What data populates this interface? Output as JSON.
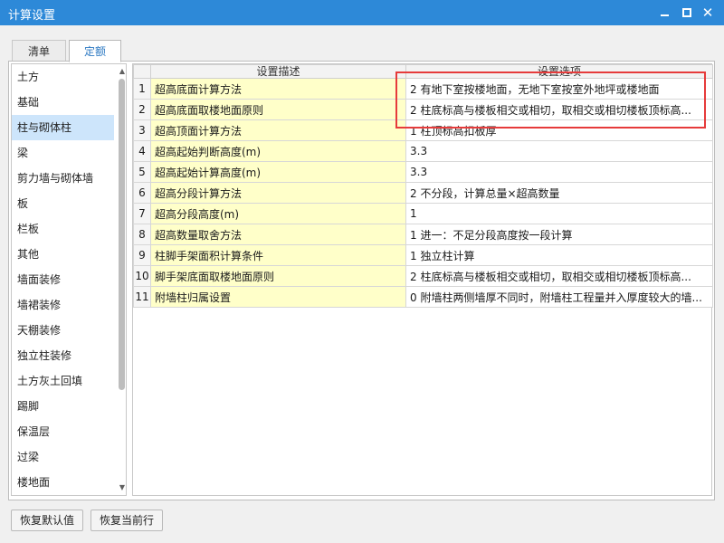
{
  "window": {
    "title": "计算设置"
  },
  "tabs": [
    "清单",
    "定额"
  ],
  "active_tab": "定额",
  "categories": [
    "土方",
    "基础",
    "柱与砌体柱",
    "梁",
    "剪力墙与砌体墙",
    "板",
    "栏板",
    "其他",
    "墙面装修",
    "墙裙装修",
    "天棚装修",
    "独立柱装修",
    "土方灰土回填",
    "踢脚",
    "保温层",
    "过梁",
    "楼地面"
  ],
  "selected_category": "柱与砌体柱",
  "table": {
    "headers": [
      "",
      "设置描述",
      "设置选项"
    ],
    "rows": [
      {
        "num": "1",
        "desc": "超高底面计算方法",
        "value": "2 有地下室按楼地面，无地下室按室外地坪或楼地面"
      },
      {
        "num": "2",
        "desc": "超高底面取楼地面原则",
        "value": "2 柱底标高与楼板相交或相切，取相交或相切楼板顶标高..."
      },
      {
        "num": "3",
        "desc": "超高顶面计算方法",
        "value": "1 柱顶标高扣板厚"
      },
      {
        "num": "4",
        "desc": "超高起始判断高度(m)",
        "value": "3.3"
      },
      {
        "num": "5",
        "desc": "超高起始计算高度(m)",
        "value": "3.3"
      },
      {
        "num": "6",
        "desc": "超高分段计算方法",
        "value": "2 不分段，计算总量×超高数量"
      },
      {
        "num": "7",
        "desc": "超高分段高度(m)",
        "value": "1"
      },
      {
        "num": "8",
        "desc": "超高数量取舍方法",
        "value": "1 进一：不足分段高度按一段计算"
      },
      {
        "num": "9",
        "desc": "柱脚手架面积计算条件",
        "value": "1 独立柱计算"
      },
      {
        "num": "10",
        "desc": "脚手架底面取楼地面原则",
        "value": "2 柱底标高与楼板相交或相切，取相交或相切楼板顶标高..."
      },
      {
        "num": "11",
        "desc": "附墙柱归属设置",
        "value": "0 附墙柱两侧墙厚不同时，附墙柱工程量并入厚度较大的墙..."
      }
    ]
  },
  "buttons": {
    "restore_default": "恢复默认值",
    "restore_row": "恢复当前行"
  },
  "icons": {
    "minimize": "minimize-icon",
    "maximize": "maximize-icon",
    "close": "close-icon"
  },
  "colors": {
    "titlebar": "#2d89d8",
    "desc_cell": "#ffffc9",
    "selected_item": "#cde5fb",
    "highlight_box": "#e63b3b"
  }
}
